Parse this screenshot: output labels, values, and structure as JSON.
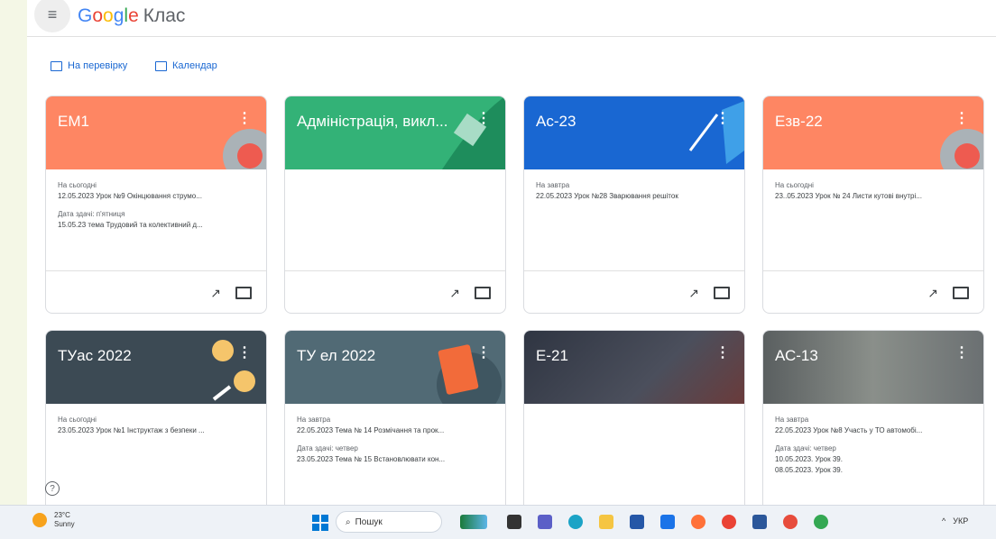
{
  "app": {
    "logo_google": "Google",
    "product": "Клас"
  },
  "toplinks": {
    "review": "На перевірку",
    "calendar": "Календар"
  },
  "cards": [
    {
      "title": "ЕМ1",
      "color": "#fe8663",
      "l1": "На сьогодні",
      "t1": "12.05.2023 Урок №9 Окінцювання струмо...",
      "l2": "Дата здачі: п'ятниця",
      "t2": "15.05.23 тема Трудовий та колективний д..."
    },
    {
      "title": "Адміністрація, викл...",
      "color": "#33b277",
      "l1": "",
      "t1": "",
      "l2": "",
      "t2": ""
    },
    {
      "title": "Ас-23",
      "color": "#1967d2",
      "l1": "На завтра",
      "t1": "22.05.2023 Урок №28 Зварювання решіток",
      "l2": "",
      "t2": ""
    },
    {
      "title": "Езв-22",
      "color": "#fe8663",
      "l1": "На сьогодні",
      "t1": "23..05.2023 Урок № 24 Листи кутові внутрі...",
      "l2": "",
      "t2": ""
    },
    {
      "title": "ТУас 2022",
      "color": "#3c4a54",
      "l1": "На сьогодні",
      "t1": "23.05.2023 Урок №1 Інструктаж з безпеки ...",
      "l2": "",
      "t2": ""
    },
    {
      "title": "ТУ ел 2022",
      "color": "#516a75",
      "l1": "На завтра",
      "t1": "22.05.2023 Тема № 14 Розмічання та прок...",
      "l2": "Дата здачі: четвер",
      "t2": "23.05.2023 Тема № 15 Встановлювати кон..."
    },
    {
      "title": "Е-21",
      "color": "#3a3f4a",
      "l1": "",
      "t1": "",
      "l2": "",
      "t2": ""
    },
    {
      "title": "АС-13",
      "color": "#6b7072",
      "l1": "На завтра",
      "t1": "22.05.2023 Урок №8 Участь у ТО автомобі...",
      "l2": "Дата здачі: четвер",
      "t2": "10.05.2023. Урок 39.",
      "t3": "08.05.2023. Урок 39."
    }
  ],
  "taskbar": {
    "temp": "23°C",
    "weather": "Sunny",
    "search": "Пошук",
    "lang": "УКР"
  },
  "icons": {
    "menu": "hamburger-icon",
    "trend": "trending-icon",
    "folder": "folder-icon",
    "help": "help-icon",
    "kebab": "more-vert-icon"
  }
}
